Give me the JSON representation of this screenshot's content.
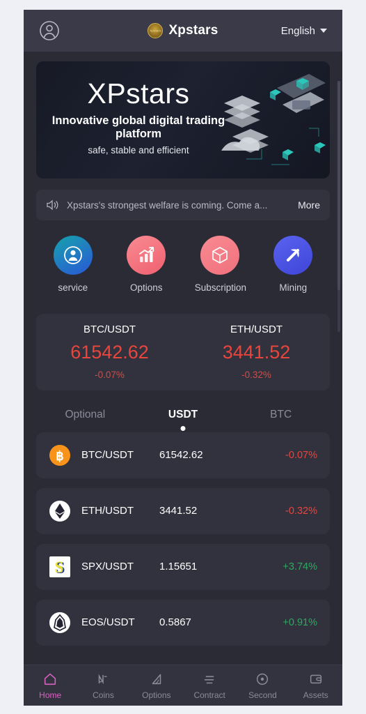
{
  "header": {
    "avatar_icon": "user-circle-icon",
    "brand_name": "Xpstars",
    "brand_seal_text": "Xpstars",
    "language": "English",
    "caret_icon": "chevron-down-icon"
  },
  "banner": {
    "title": "XPstars",
    "subtitle": "Innovative global digital trading platform",
    "tagline": "safe, stable and efficient"
  },
  "notice": {
    "speaker_icon": "speaker-icon",
    "text": "Xpstars's strongest welfare is coming. Come a...",
    "more_label": "More"
  },
  "quick_actions": [
    {
      "label": "service",
      "icon": "customer-service-icon",
      "color": "#1f7fa8"
    },
    {
      "label": "Options",
      "icon": "bar-chart-arrow-icon",
      "color": "#f4707c"
    },
    {
      "label": "Subscription",
      "icon": "cube-icon",
      "color": "#f4707c"
    },
    {
      "label": "Mining",
      "icon": "pickaxe-icon",
      "color": "#4c54e0"
    }
  ],
  "price_cards": [
    {
      "pair": "BTC/USDT",
      "value": "61542.62",
      "change": "-0.07%",
      "color": "#e8453c"
    },
    {
      "pair": "ETH/USDT",
      "value": "3441.52",
      "change": "-0.32%",
      "color": "#e8453c"
    }
  ],
  "tabs": [
    {
      "label": "Optional",
      "active": false
    },
    {
      "label": "USDT",
      "active": true
    },
    {
      "label": "BTC",
      "active": false
    }
  ],
  "market_table": {
    "rows": [
      {
        "symbol": "BTC/USDT",
        "price": "61542.62",
        "change": "-0.07%",
        "color": "#e8453c",
        "icon": "bitcoin-icon"
      },
      {
        "symbol": "ETH/USDT",
        "price": "3441.52",
        "change": "-0.32%",
        "color": "#e8453c",
        "icon": "ethereum-icon"
      },
      {
        "symbol": "SPX/USDT",
        "price": "1.15651",
        "change": "+3.74%",
        "color": "#2fa860",
        "icon": "spx-icon"
      },
      {
        "symbol": "EOS/USDT",
        "price": "0.5867",
        "change": "+0.91%",
        "color": "#2fa860",
        "icon": "eos-icon"
      }
    ]
  },
  "bottom_nav": [
    {
      "label": "Home",
      "icon": "home-icon",
      "active": true
    },
    {
      "label": "Coins",
      "icon": "zigzag-icon",
      "active": false
    },
    {
      "label": "Options",
      "icon": "triangle-icon",
      "active": false
    },
    {
      "label": "Contract",
      "icon": "lines-icon",
      "active": false
    },
    {
      "label": "Second",
      "icon": "target-icon",
      "active": false
    },
    {
      "label": "Assets",
      "icon": "wallet-icon",
      "active": false
    }
  ],
  "theme": {
    "accent": "#d863c0",
    "up": "#2fa860",
    "down": "#e8453c",
    "panel": "#32323e",
    "bg": "#2b2b36"
  }
}
